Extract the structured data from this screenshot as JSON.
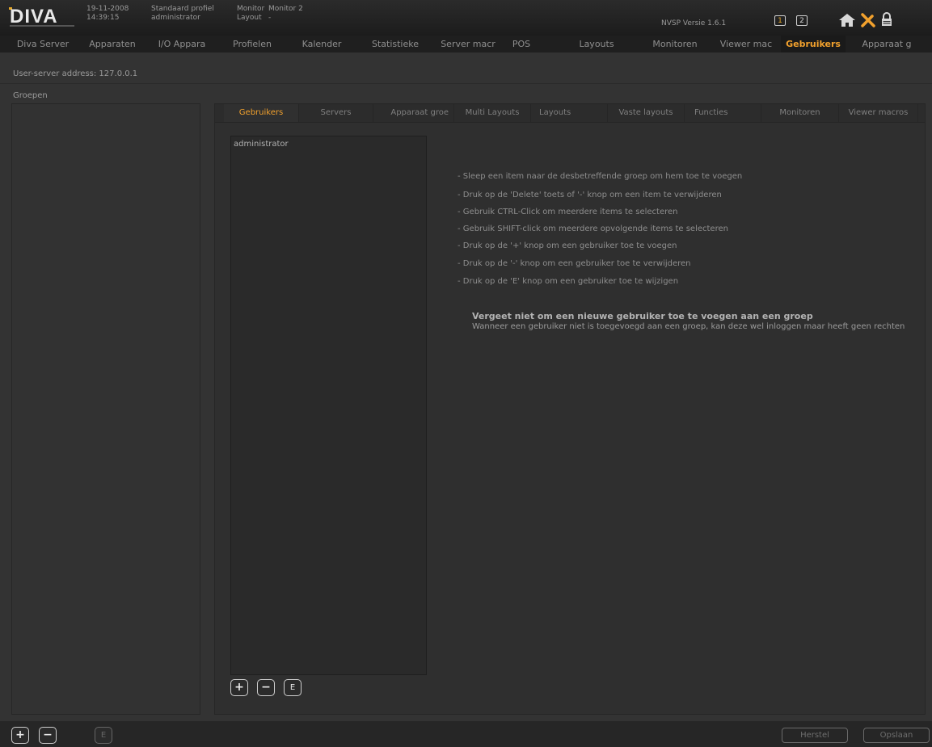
{
  "header": {
    "logo_text": "DIVA",
    "date": "19-11-2008",
    "time": "14:39:15",
    "profile": "Standaard profiel",
    "user": "administrator",
    "monitor_label": "Monitor",
    "monitor_value": "Monitor 2",
    "layout_label": "Layout",
    "layout_value": "-",
    "version": "NVSP Versie 1.6.1",
    "monitor_buttons": [
      "1",
      "2"
    ],
    "icons": [
      "home-icon",
      "tools-icon",
      "lock-icon"
    ]
  },
  "nav": {
    "tabs": [
      "Diva Server",
      "Apparaten",
      "I/O Appara",
      "Profielen",
      "Kalender",
      "Statistieke",
      "Server macr",
      "POS",
      "Layouts",
      "Monitoren",
      "Viewer mac",
      "Gebruikers",
      "Apparaat g"
    ],
    "active": "Gebruikers"
  },
  "address": "User-server address: 127.0.0.1",
  "groups_label": "Groepen",
  "subtabs": {
    "tabs": [
      "Gebruikers",
      "Servers",
      "Apparaat groe",
      "Multi Layouts",
      "Layouts",
      "Vaste layouts",
      "Functies",
      "Monitoren",
      "Viewer macros"
    ],
    "active": "Gebruikers"
  },
  "users": [
    "administrator"
  ],
  "instructions": [
    "- Sleep een item naar de desbetreffende groep om hem toe te voegen",
    "- Druk op de 'Delete' toets of '-' knop om een item te verwijderen",
    "- Gebruik CTRL-Click om meerdere items te selecteren",
    "- Gebruik SHIFT-click om meerdere opvolgende items te selecteren",
    "- Druk op de '+' knop om een gebruiker toe te voegen",
    "- Druk op de '-' knop om een gebruiker toe te verwijderen",
    "- Druk op de 'E' knop om een gebruiker toe te wijzigen"
  ],
  "note": {
    "title": "Vergeet niet om een nieuwe gebruiker toe te voegen aan een groep",
    "text": "Wanneer een gebruiker niet is toegevoegd aan een groep, kan deze wel inloggen maar heeft geen rechten"
  },
  "buttons": {
    "add": "+",
    "remove": "−",
    "edit": "E",
    "herstel": "Herstel",
    "opslaan": "Opslaan"
  },
  "colors": {
    "accent": "#f2a12d",
    "background": "#333333"
  }
}
